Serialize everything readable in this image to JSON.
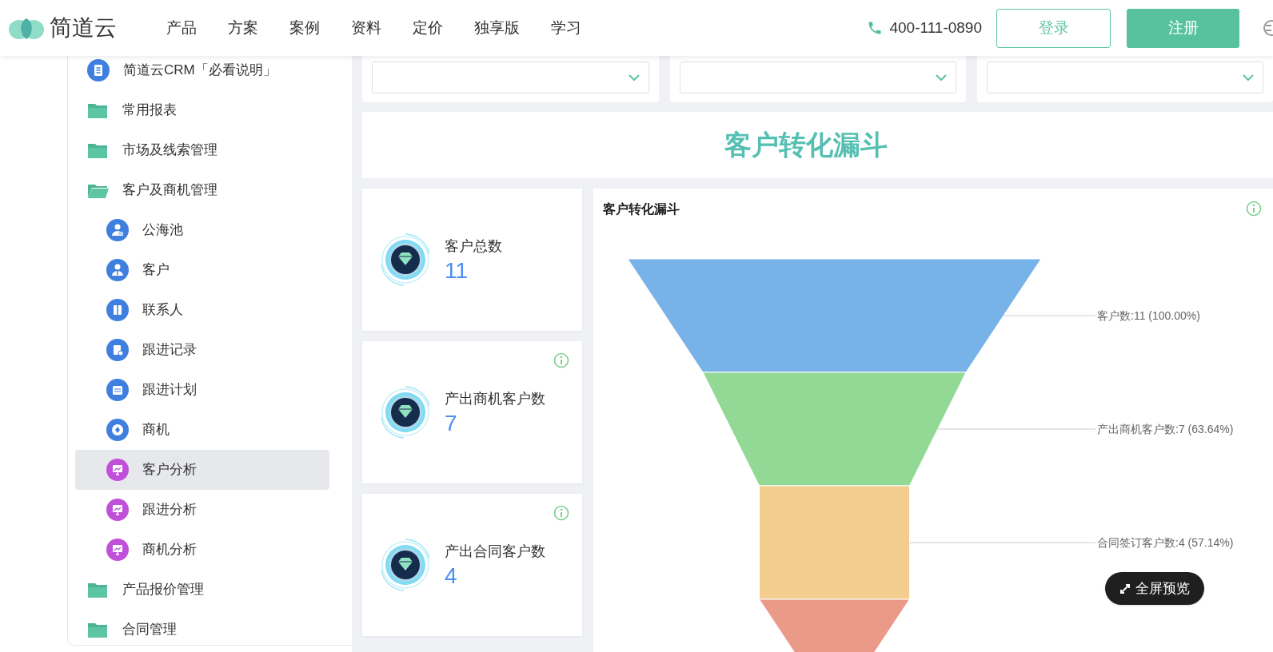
{
  "header": {
    "logo_text": "简道云",
    "nav": [
      "产品",
      "方案",
      "案例",
      "资料",
      "定价",
      "独享版",
      "学习"
    ],
    "phone": "400-111-0890",
    "login_button": "登录",
    "register_button": "注册"
  },
  "sidebar": {
    "items": [
      {
        "kind": "doc",
        "label": "简道云CRM「必看说明」",
        "selected": false
      },
      {
        "kind": "folder",
        "label": "常用报表",
        "expanded": false,
        "selected": false
      },
      {
        "kind": "folder",
        "label": "市场及线索管理",
        "expanded": false,
        "selected": false
      },
      {
        "kind": "folder",
        "label": "客户及商机管理",
        "expanded": true,
        "selected": false,
        "children": [
          {
            "kind": "pool",
            "label": "公海池",
            "selected": false
          },
          {
            "kind": "person",
            "label": "客户",
            "selected": false
          },
          {
            "kind": "contact",
            "label": "联系人",
            "selected": false
          },
          {
            "kind": "record",
            "label": "跟进记录",
            "selected": false
          },
          {
            "kind": "plan",
            "label": "跟进计划",
            "selected": false
          },
          {
            "kind": "opportunity",
            "label": "商机",
            "selected": false
          },
          {
            "kind": "analysis",
            "label": "客户分析",
            "selected": true
          },
          {
            "kind": "analysis",
            "label": "跟进分析",
            "selected": false
          },
          {
            "kind": "analysis",
            "label": "商机分析",
            "selected": false
          }
        ]
      },
      {
        "kind": "folder",
        "label": "产品报价管理",
        "expanded": false,
        "selected": false
      },
      {
        "kind": "folder",
        "label": "合同管理",
        "expanded": false,
        "selected": false
      }
    ]
  },
  "title_banner": "客户转化漏斗",
  "stats": [
    {
      "label": "客户总数",
      "value": "11",
      "info": false
    },
    {
      "label": "产出商机客户数",
      "value": "7",
      "info": true
    },
    {
      "label": "产出合同客户数",
      "value": "4",
      "info": true
    }
  ],
  "chart": {
    "title": "客户转化漏斗",
    "info": true,
    "stages": [
      {
        "label": "客户数:11 (100.00%)",
        "color": "#77b2e9"
      },
      {
        "label": "产出商机客户数:7 (63.64%)",
        "color": "#92d996"
      },
      {
        "label": "合同签订客户数:4 (57.14%)",
        "color": "#f2cd8d"
      },
      {
        "color": "#eb9a8a"
      }
    ],
    "fullscreen_button": "全屏预览"
  }
}
